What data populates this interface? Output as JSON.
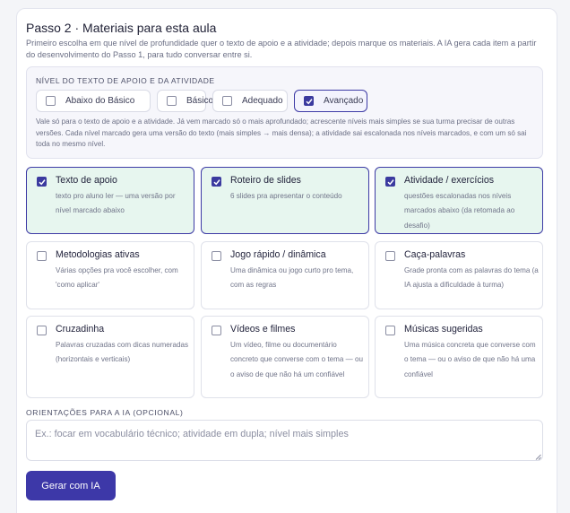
{
  "step": {
    "title": "Passo 2 · Materiais para esta aula",
    "subtitle": "Primeiro escolha em que nível de profundidade quer o texto de apoio e a atividade; depois marque os materiais. A IA gera cada item a partir do desenvolvimento do Passo 1, para tudo conversar entre si."
  },
  "level": {
    "heading": "NÍVEL DO TEXTO DE APOIO E DA ATIVIDADE",
    "options": [
      {
        "label": "Abaixo do Básico",
        "checked": false
      },
      {
        "label": "Básico",
        "checked": false
      },
      {
        "label": "Adequado",
        "checked": false
      },
      {
        "label": "Avançado",
        "checked": true
      }
    ],
    "note": "Vale só para o texto de apoio e a atividade. Já vem marcado só o mais aprofundado; acrescente níveis mais simples se sua turma precisar de outras versões. Cada nível marcado gera uma versão do texto (mais simples → mais densa); a atividade sai escalonada nos níveis marcados, e com um só sai toda no mesmo nível."
  },
  "materials": [
    {
      "title": "Texto de apoio",
      "desc": "texto pro aluno ler — uma versão por nível marcado abaixo",
      "checked": true
    },
    {
      "title": "Roteiro de slides",
      "desc": "6 slides pra apresentar o conteúdo",
      "checked": true
    },
    {
      "title": "Atividade / exercícios",
      "desc": "questões escalonadas nos níveis marcados abaixo (da retomada ao desafio)",
      "checked": true
    },
    {
      "title": "Metodologias ativas",
      "desc": "Várias opções pra você escolher, com 'como aplicar'",
      "checked": false
    },
    {
      "title": "Jogo rápido / dinâmica",
      "desc": "Uma dinâmica ou jogo curto pro tema, com as regras",
      "checked": false
    },
    {
      "title": "Caça-palavras",
      "desc": "Grade pronta com as palavras do tema (a IA ajusta a dificuldade à turma)",
      "checked": false
    },
    {
      "title": "Cruzadinha",
      "desc": "Palavras cruzadas com dicas numeradas (horizontais e verticais)",
      "checked": false
    },
    {
      "title": "Vídeos e filmes",
      "desc": "Um vídeo, filme ou documentário concreto que converse com o tema — ou o aviso de que não há um confiável",
      "checked": false
    },
    {
      "title": "Músicas sugeridas",
      "desc": "Uma música concreta que converse com o tema — ou o aviso de que não há uma confiável",
      "checked": false
    }
  ],
  "guidance": {
    "label": "ORIENTAÇÕES PARA A IA (OPCIONAL)",
    "value": "",
    "placeholder": "Ex.: focar em vocabulário técnico; atividade em dupla; nível mais simples"
  },
  "actions": {
    "generate_label": "Gerar com IA"
  },
  "colors": {
    "accent": "#3d38a8",
    "selected_bg": "#e7f6ef",
    "check": "#3b3a9f"
  }
}
